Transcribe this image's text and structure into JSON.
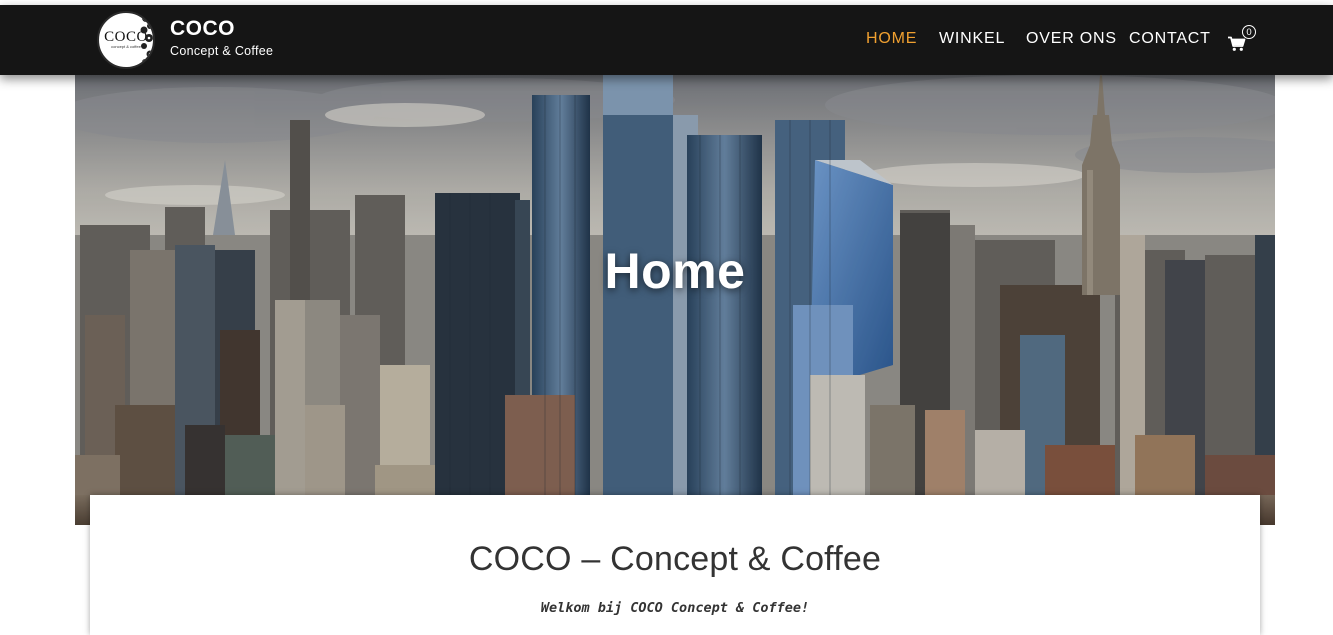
{
  "brand": {
    "name": "COCO",
    "tagline": "Concept & Coffee",
    "logo_text": "COCO",
    "logo_subtext": "concept & coffee"
  },
  "nav": {
    "items": [
      {
        "label": "HOME",
        "active": true
      },
      {
        "label": "WINKEL",
        "active": false
      },
      {
        "label": "OVER ONS",
        "active": false
      },
      {
        "label": "CONTACT",
        "active": false
      }
    ],
    "cart_count": "0",
    "cart_icon": "shopping-cart-icon"
  },
  "hero": {
    "title": "Home"
  },
  "content": {
    "title": "COCO – Concept & Coffee",
    "welcome": "Welkom bij COCO Concept & Coffee!"
  },
  "colors": {
    "navbar_bg": "#151515",
    "accent": "#f0a030",
    "text": "#333333"
  }
}
